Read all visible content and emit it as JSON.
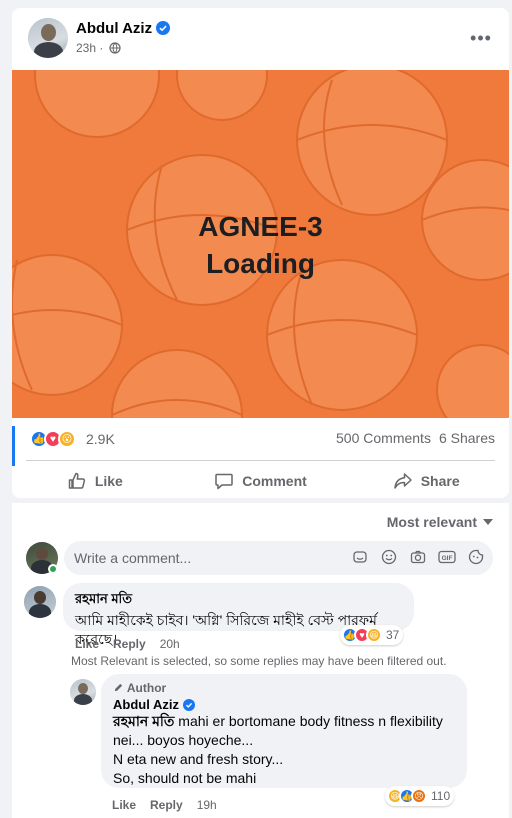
{
  "post": {
    "author": "Abdul Aziz",
    "time": "23h ·",
    "more_label": "•••",
    "image_text_line1": "AGNEE-3",
    "image_text_line2": "Loading",
    "reaction_count": "2.9K",
    "comments_count": "500 Comments",
    "shares_count": "6 Shares",
    "reactions": [
      "like",
      "love",
      "wow"
    ],
    "actions": {
      "like": "Like",
      "comment": "Comment",
      "share": "Share"
    },
    "colors": {
      "accent": "#1877f2",
      "image_bg": "#f07a3c"
    }
  },
  "comments_section": {
    "sort_label": "Most relevant",
    "compose_placeholder": "Write a comment...",
    "compose_icons": [
      "sticker-icon",
      "emoji-icon",
      "camera-icon",
      "gif-icon",
      "avatar-sticker-icon"
    ],
    "filter_note": "Most Relevant is selected, so some replies may have been filtered out.",
    "comments": [
      {
        "name": "রহমান মতি",
        "text": "আমি মাহীকেই চাইব। 'অগ্নি' সিরিজে মাহীই বেস্ট পারফর্ম করেছে।",
        "like": "Like",
        "reply": "Reply",
        "time": "20h",
        "reaction_count": "37",
        "reactions": [
          "like",
          "love",
          "haha"
        ]
      }
    ],
    "reply": {
      "author_tag": "Author",
      "name": "Abdul Aziz",
      "mention": "রহমান মতি",
      "text_line1": " mahi er bortomane body fitness n flexibility",
      "text_line2": "nei... boyos hoyeche...",
      "text_line3": "N eta new and fresh story...",
      "text_line4": "So, should not be mahi",
      "like": "Like",
      "reply": "Reply",
      "time": "19h",
      "reaction_count": "110",
      "reactions": [
        "haha",
        "like",
        "angry"
      ]
    }
  }
}
